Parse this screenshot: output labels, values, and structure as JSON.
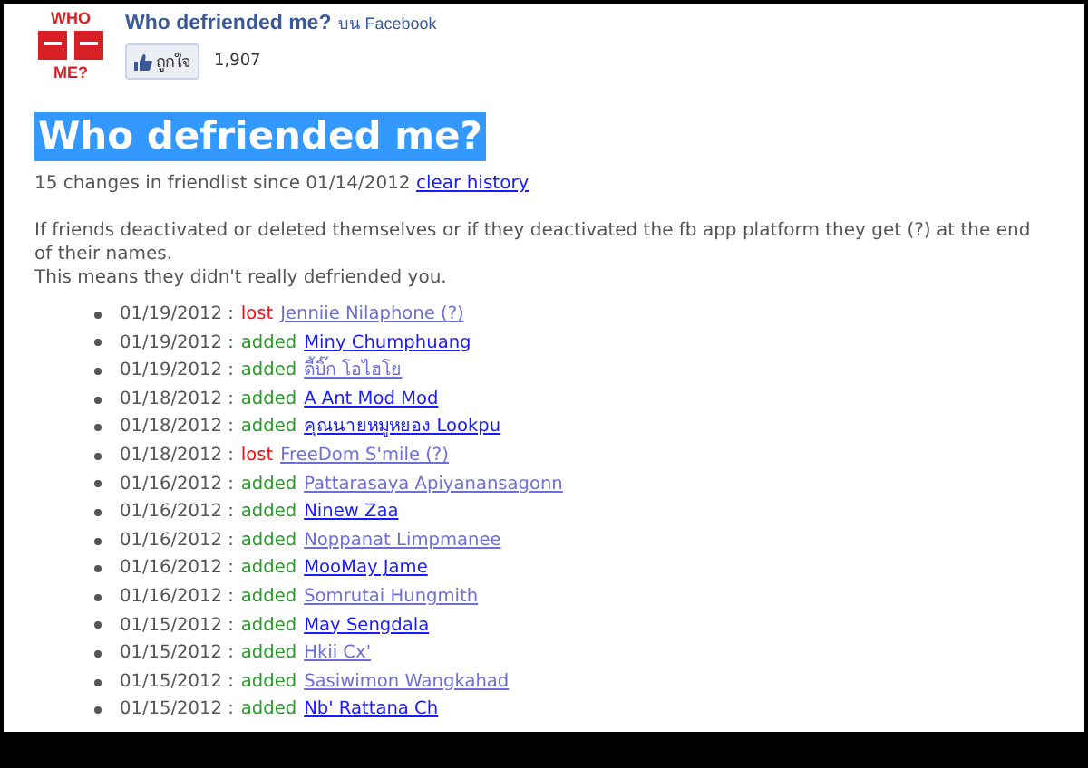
{
  "app": {
    "logo_top": "WHO",
    "logo_bottom": "ME?",
    "title": "Who defriended me?",
    "source": "บน Facebook",
    "like_button": "ถูกใจ",
    "like_count": "1,907"
  },
  "heading": {
    "text": "Who defriended me?",
    "selected": true
  },
  "summary": {
    "text": "15 changes in friendlist since 01/14/2012",
    "link": "clear history"
  },
  "notes": [
    "If friends deactivated or deleted themselves or if they deactivated the fb app platform they get (?) at the end of their names.",
    "This means they didn't really defriended you."
  ],
  "changes": [
    {
      "date": "01/19/2012 :",
      "action": "lost",
      "kind": "lost",
      "name": "Jenniie Nilaphone (?)",
      "visited": true
    },
    {
      "date": "01/19/2012 :",
      "action": "added",
      "kind": "added",
      "name": "Miny Chumphuang",
      "visited": false
    },
    {
      "date": "01/19/2012 :",
      "action": "added",
      "kind": "added",
      "name": "ดี้บิ๊ก โอไฮโย",
      "visited": true
    },
    {
      "date": "01/18/2012 :",
      "action": "added",
      "kind": "added",
      "name": "A Ant Mod Mod",
      "visited": false
    },
    {
      "date": "01/18/2012 :",
      "action": "added",
      "kind": "added",
      "name": "คุณนายหมูหยอง Lookpu",
      "visited": false
    },
    {
      "date": "01/18/2012 :",
      "action": "lost",
      "kind": "lost",
      "name": "FreeDom S'mile (?)",
      "visited": true
    },
    {
      "date": "01/16/2012 :",
      "action": "added",
      "kind": "added",
      "name": "Pattarasaya Apiyanansagonn",
      "visited": true
    },
    {
      "date": "01/16/2012 :",
      "action": "added",
      "kind": "added",
      "name": "Ninew Zaa",
      "visited": false
    },
    {
      "date": "01/16/2012 :",
      "action": "added",
      "kind": "added",
      "name": "Noppanat Limpmanee",
      "visited": true
    },
    {
      "date": "01/16/2012 :",
      "action": "added",
      "kind": "added",
      "name": "MooMay Jame",
      "visited": false
    },
    {
      "date": "01/16/2012 :",
      "action": "added",
      "kind": "added",
      "name": "Somrutai Hungmith",
      "visited": true
    },
    {
      "date": "01/15/2012 :",
      "action": "added",
      "kind": "added",
      "name": "May Sengdala",
      "visited": false
    },
    {
      "date": "01/15/2012 :",
      "action": "added",
      "kind": "added",
      "name": "Hkii Cx'",
      "visited": true
    },
    {
      "date": "01/15/2012 :",
      "action": "added",
      "kind": "added",
      "name": "Sasiwimon Wangkahad",
      "visited": true
    },
    {
      "date": "01/15/2012 :",
      "action": "added",
      "kind": "added",
      "name": "Nb' Rattana Ch",
      "visited": false
    }
  ]
}
